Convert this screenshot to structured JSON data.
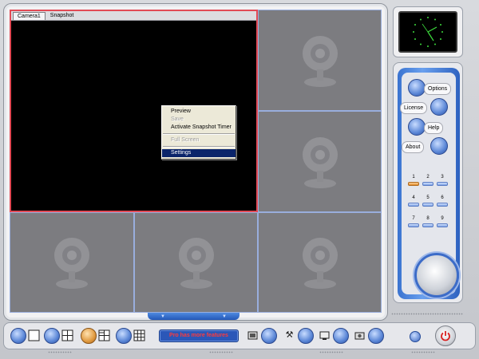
{
  "camera_tabs": [
    {
      "label": "Camera1",
      "active": true
    },
    {
      "label": "Snapshot",
      "active": false
    }
  ],
  "context_menu": {
    "items": [
      {
        "label": "Preview",
        "state": "enabled"
      },
      {
        "label": "Save",
        "state": "disabled"
      },
      {
        "label": "Activate Snapshot Timer",
        "state": "enabled"
      },
      {
        "separator": true
      },
      {
        "label": "Full Screen",
        "state": "disabled"
      },
      {
        "separator": true
      },
      {
        "label": "Settings",
        "state": "selected"
      }
    ]
  },
  "side_panel": {
    "buttons": [
      {
        "label": "Options"
      },
      {
        "label": "License"
      },
      {
        "label": "Help"
      },
      {
        "label": "About"
      }
    ],
    "camera_numbers": [
      "1",
      "2",
      "3",
      "4",
      "5",
      "6",
      "7",
      "8",
      "9"
    ],
    "active_camera": "1"
  },
  "toolbar": {
    "promo_label": "Pro has more features",
    "icons": [
      "layout-1x1-icon",
      "layout-2x2-icon",
      "layout-2x2-alt-icon",
      "layout-3x3-icon",
      "record-icon",
      "tools-icon",
      "monitor-icon",
      "snapshot-icon",
      "power-icon"
    ]
  },
  "colors": {
    "accent_blue": "#2b57b8",
    "selection_border": "#e24a55",
    "promo_text": "#ff3b3b",
    "clock_green": "#3ddc3d"
  }
}
